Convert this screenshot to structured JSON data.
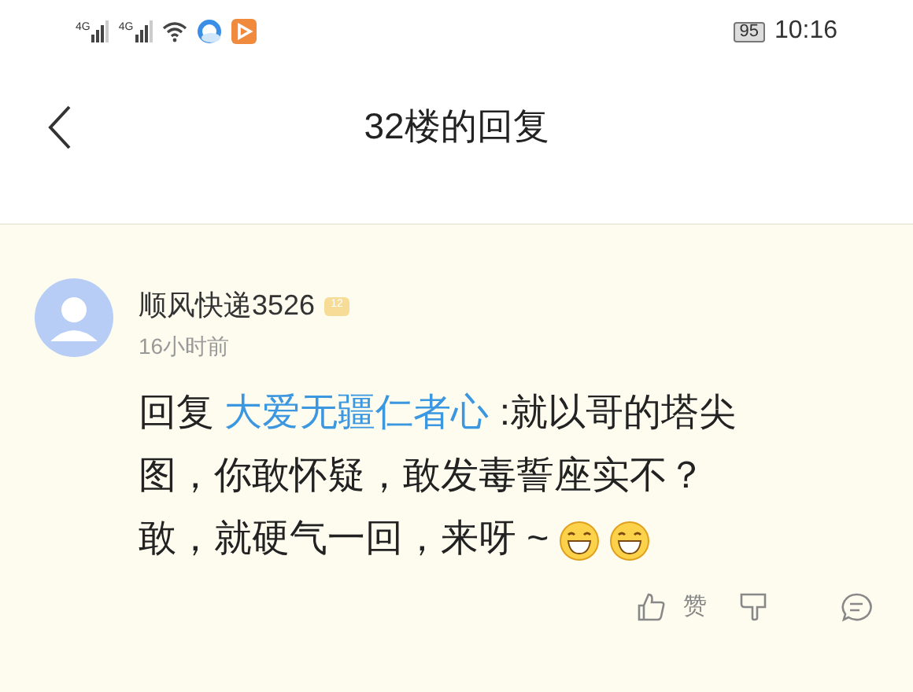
{
  "status_bar": {
    "signal_1": "4G",
    "signal_2": "4G",
    "battery": "95",
    "time": "10:16"
  },
  "header": {
    "title": "32楼的回复"
  },
  "reply": {
    "username": "顺风快递3526",
    "level": "12",
    "time": "16小时前",
    "prefix": "回复",
    "mention": "大爱无疆仁者心",
    "text": ":就以哥的塔尖图，你敢怀疑，敢发毒誓座实不？敢，就硬气一回，来呀 ~",
    "emojis": [
      {
        "kind": "grin"
      },
      {
        "kind": "grin"
      }
    ],
    "like_label": "赞"
  }
}
